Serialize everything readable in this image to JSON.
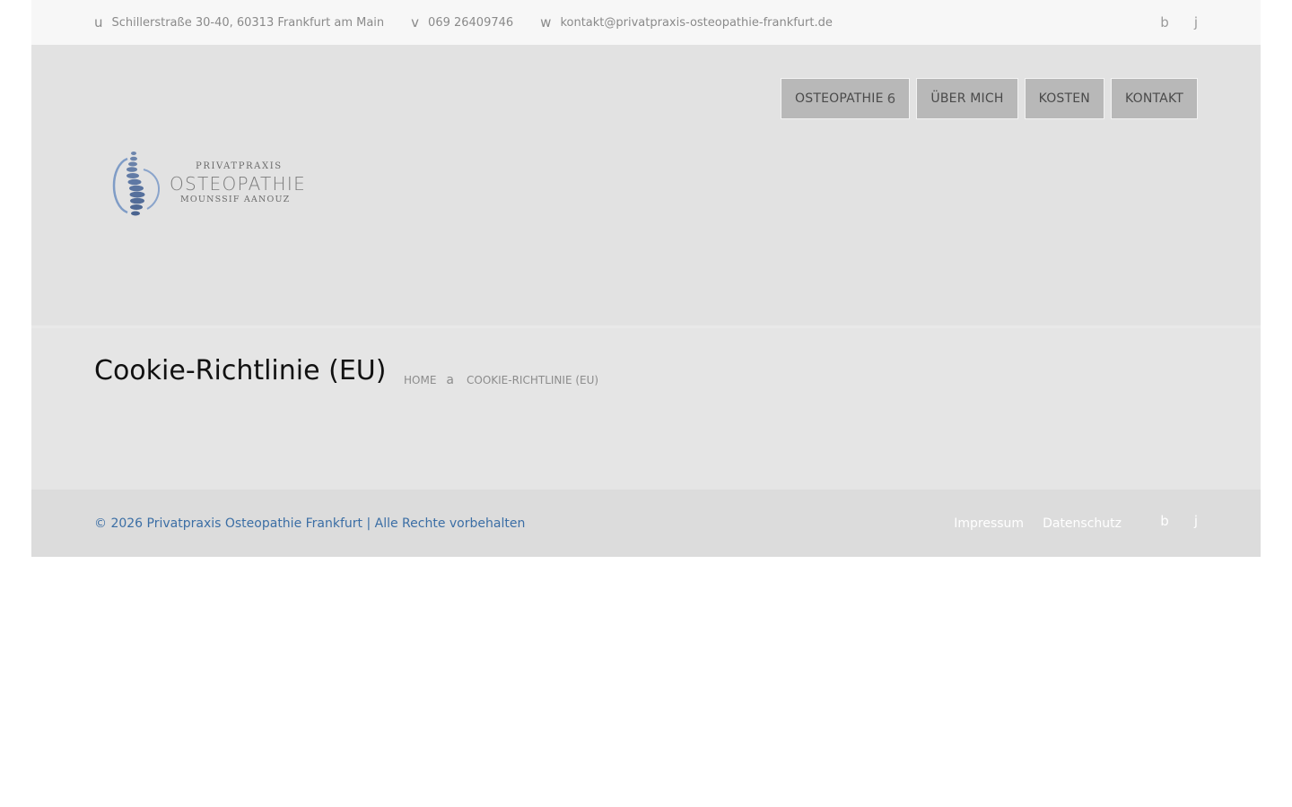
{
  "topbar": {
    "address_icon": "u",
    "address": "Schillerstraße 30-40, 60313 Frankfurt am Main",
    "phone_icon": "v",
    "phone": "069 26409746",
    "email_icon": "w",
    "email": "kontakt@privatpraxis-osteopathie-frankfurt.de",
    "social": [
      "b",
      "j"
    ]
  },
  "nav": {
    "items": [
      {
        "label": "OSTEOPATHIE",
        "caret": "6"
      },
      {
        "label": "ÜBER MICH"
      },
      {
        "label": "KOSTEN"
      },
      {
        "label": "KONTAKT"
      }
    ]
  },
  "logo": {
    "line1": "PRIVATPRAXIS",
    "line2": "OSTEOPATHIE",
    "line3": "MOUNSSIF AANOUZ",
    "icon": "spine-logo-icon"
  },
  "page": {
    "title": "Cookie-Richtlinie (EU)",
    "breadcrumb": {
      "home": "HOME",
      "separator": "a",
      "current": "COOKIE-RICHTLINIE (EU)"
    }
  },
  "footer": {
    "copyright": "© 2026 Privatpraxis Osteopathie Frankfurt | Alle Rechte vorbehalten",
    "links": [
      "Impressum",
      "Datenschutz"
    ],
    "social": [
      "b",
      "j"
    ]
  },
  "colors": {
    "topbar_bg": "#f7f7f7",
    "header_bg": "#e2e2e2",
    "nav_button_bg": "#b8b8b8",
    "footer_bg": "#dcdcdc",
    "footer_text": "#3b6ea5"
  }
}
